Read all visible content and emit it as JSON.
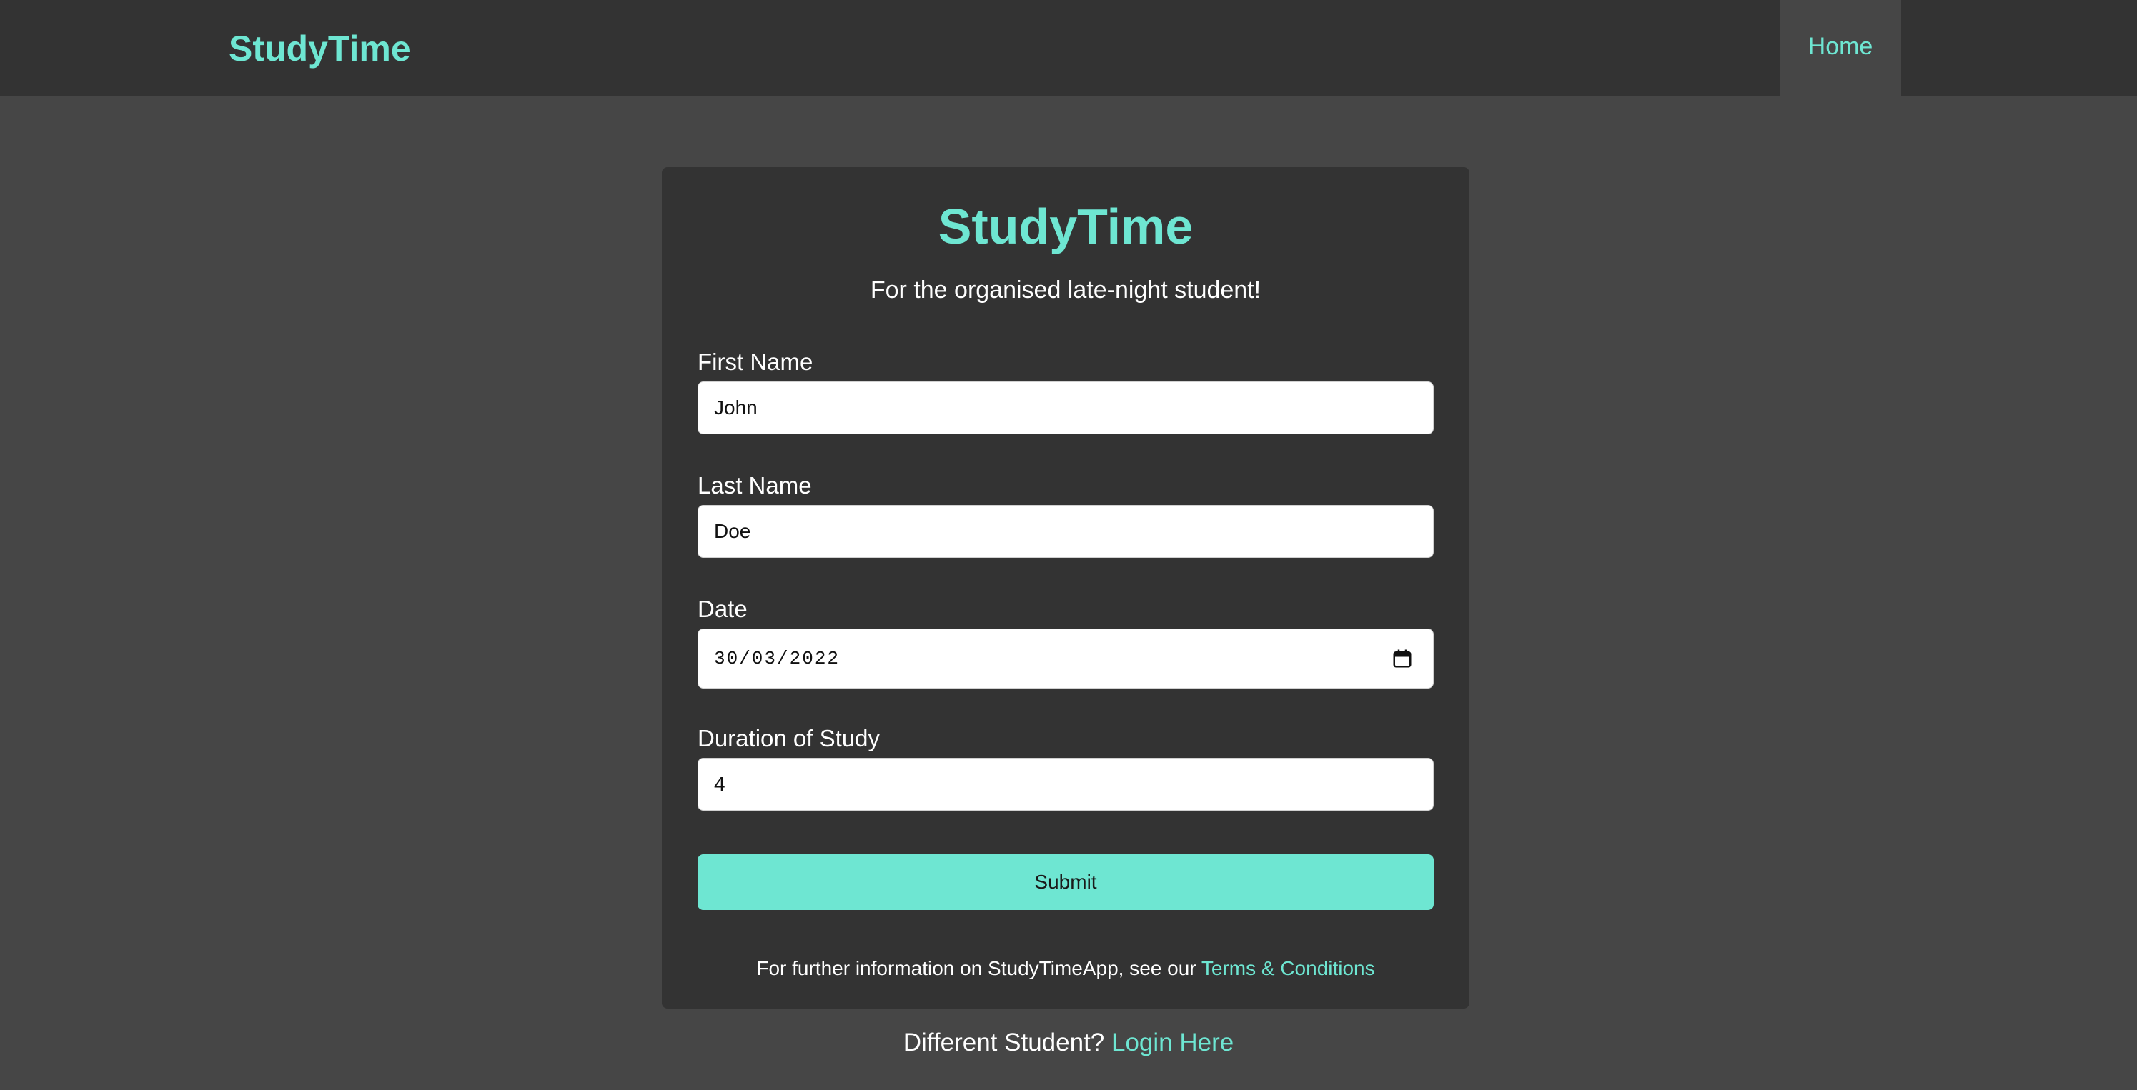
{
  "navbar": {
    "brand": "StudyTime",
    "home_label": "Home"
  },
  "form": {
    "title": "StudyTime",
    "subtitle": "For the organised late-night student!",
    "first_name": {
      "label": "First Name",
      "value": "John"
    },
    "last_name": {
      "label": "Last Name",
      "value": "Doe"
    },
    "date": {
      "label": "Date",
      "value": "30/03/2022",
      "icon": "calendar-icon"
    },
    "duration": {
      "label": "Duration of Study",
      "value": "4"
    },
    "submit_label": "Submit",
    "terms_prefix": "For further information on StudyTimeApp, see our",
    "terms_link": "Terms & Conditions"
  },
  "footer": {
    "prompt": "Different Student?",
    "login_link": "Login Here"
  },
  "colors": {
    "accent": "#6ee6d2",
    "page_background": "#464646",
    "panel_background": "#333333",
    "text": "#ffffff"
  }
}
